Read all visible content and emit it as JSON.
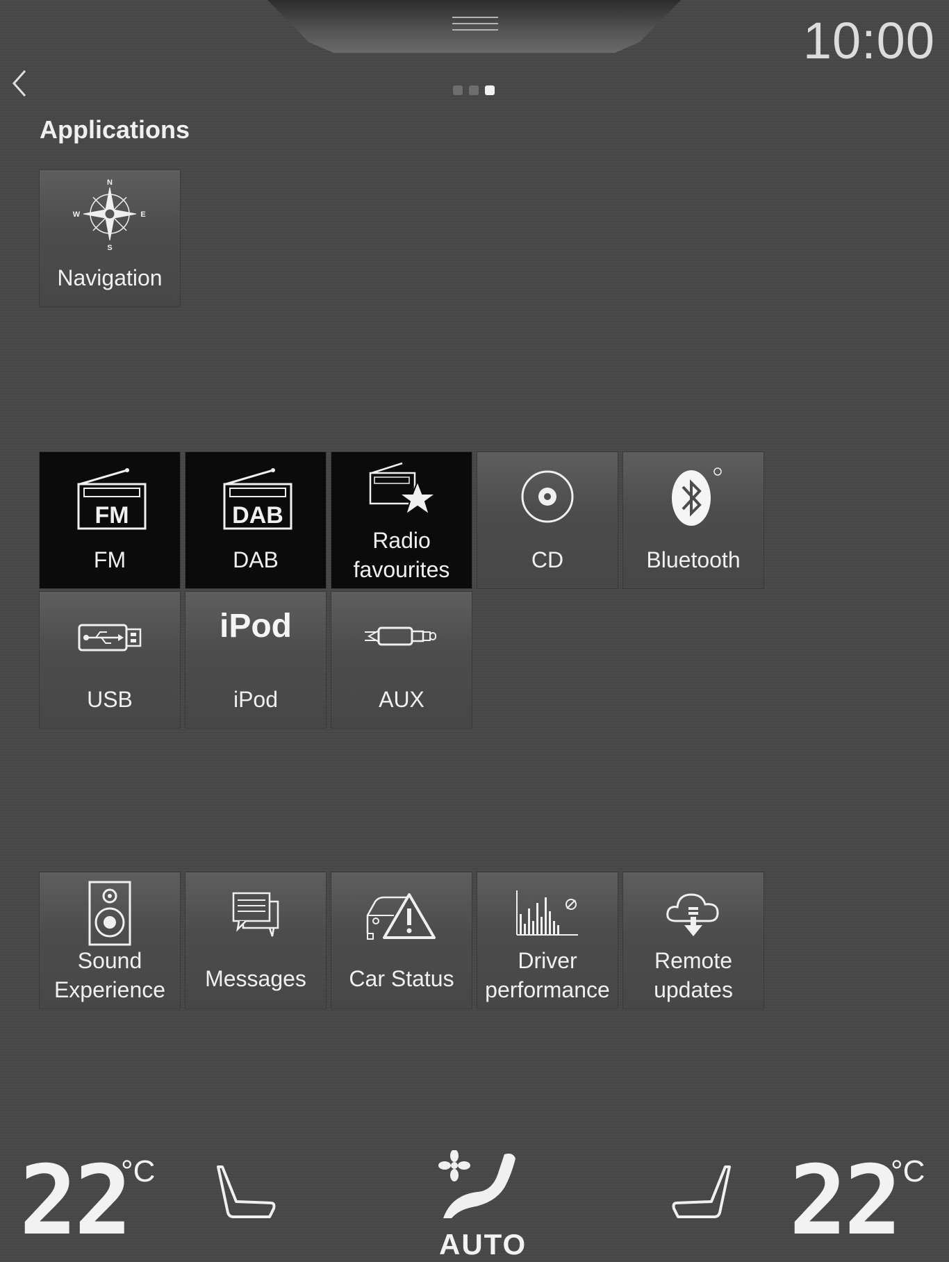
{
  "status_bar": {
    "clock": "10:00"
  },
  "pager": {
    "page_count": 3,
    "active_page": 3
  },
  "section": {
    "title": "Applications"
  },
  "apps_top": [
    {
      "label": "Navigation",
      "icon": "compass-icon"
    }
  ],
  "apps_media": [
    {
      "label": "FM",
      "icon": "fm-radio-icon",
      "icon_text": "FM",
      "active": true
    },
    {
      "label": "DAB",
      "icon": "dab-radio-icon",
      "icon_text": "DAB",
      "active": true
    },
    {
      "label": "Radio favourites",
      "icon": "radio-favourites-icon",
      "active": true
    },
    {
      "label": "CD",
      "icon": "cd-icon",
      "active": false
    },
    {
      "label": "Bluetooth",
      "icon": "bluetooth-icon",
      "active": false
    },
    {
      "label": "USB",
      "icon": "usb-icon",
      "active": false
    },
    {
      "label": "iPod",
      "icon": "ipod-icon",
      "icon_text": "iPod",
      "active": false
    },
    {
      "label": "AUX",
      "icon": "aux-jack-icon",
      "active": false
    }
  ],
  "apps_bottom": [
    {
      "label": "Sound Experience",
      "icon": "speaker-icon"
    },
    {
      "label": "Messages",
      "icon": "messages-icon"
    },
    {
      "label": "Car Status",
      "icon": "car-warning-icon"
    },
    {
      "label": "Driver performance",
      "icon": "bar-chart-icon"
    },
    {
      "label": "Remote updates",
      "icon": "cloud-download-icon"
    }
  ],
  "climate": {
    "left_temp": "22",
    "right_temp": "22",
    "unit": "°C",
    "fan_mode": "AUTO"
  }
}
